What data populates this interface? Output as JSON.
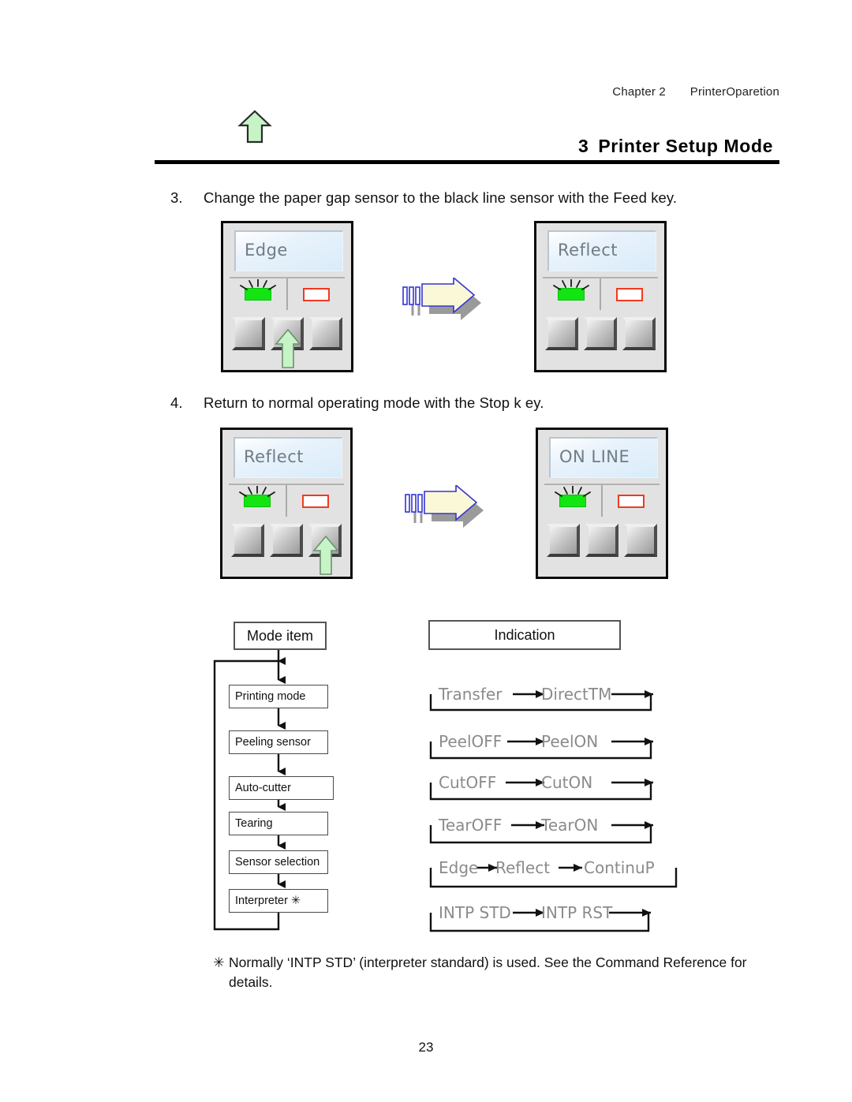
{
  "header": {
    "chapter": "Chapter 2",
    "chapter_title": "PrinterOparetion"
  },
  "title": {
    "number": "3",
    "text": "Printer Setup Mode"
  },
  "steps": [
    {
      "number": "3.",
      "text": "Change the paper gap sensor to the black line sensor with the Feed key."
    },
    {
      "number": "4.",
      "text": "Return to normal operating mode with the Stop k ey."
    }
  ],
  "panels": [
    {
      "name": "panel-edge",
      "lcd": "Edge",
      "green_led": "on-blinking",
      "red_led": "off",
      "key_arrow_button": 2
    },
    {
      "name": "panel-reflect",
      "lcd": "Reflect",
      "green_led": "on-blinking",
      "red_led": "off",
      "key_arrow_button": 0
    },
    {
      "name": "panel-reflect-2",
      "lcd": "Reflect",
      "green_led": "on-blinking",
      "red_led": "off",
      "key_arrow_button": 3
    },
    {
      "name": "panel-online",
      "lcd": "ON LINE",
      "green_led": "on-blinking",
      "red_led": "off",
      "key_arrow_button": 0
    }
  ],
  "flowchart": {
    "mode_header": "Mode  item",
    "indication_header": "Indication",
    "mode_items": [
      "Printing  mode",
      "Peeling  sensor",
      "Auto-cutter",
      "Tearing",
      "Sensor  selection",
      "Interpreter  ✳"
    ],
    "indications": [
      {
        "values": [
          "Transfer",
          "DirectTM"
        ]
      },
      {
        "values": [
          "PeelOFF",
          "PeelON"
        ]
      },
      {
        "values": [
          "CutOFF",
          "CutON"
        ]
      },
      {
        "values": [
          "TearOFF",
          "TearON"
        ]
      },
      {
        "values": [
          "Edge",
          "Reflect",
          "ContinuP"
        ]
      },
      {
        "values": [
          "INTP STD",
          "INTP RST"
        ]
      }
    ]
  },
  "footnote": {
    "marker": "✳",
    "text": "Normally ‘INTP STD’ (interpreter standard) is used. See the Command Reference for details."
  },
  "page_number": "23",
  "colors": {
    "led_green": "#12e512",
    "led_red": "#f03a20",
    "lcd_text": "#6f7c85",
    "arrow_fill": "#fbf8d8",
    "arrow_stroke": "#3434d6",
    "key_arrow_fill": "#c6f4c6",
    "indication_text": "#8b8b8b"
  }
}
